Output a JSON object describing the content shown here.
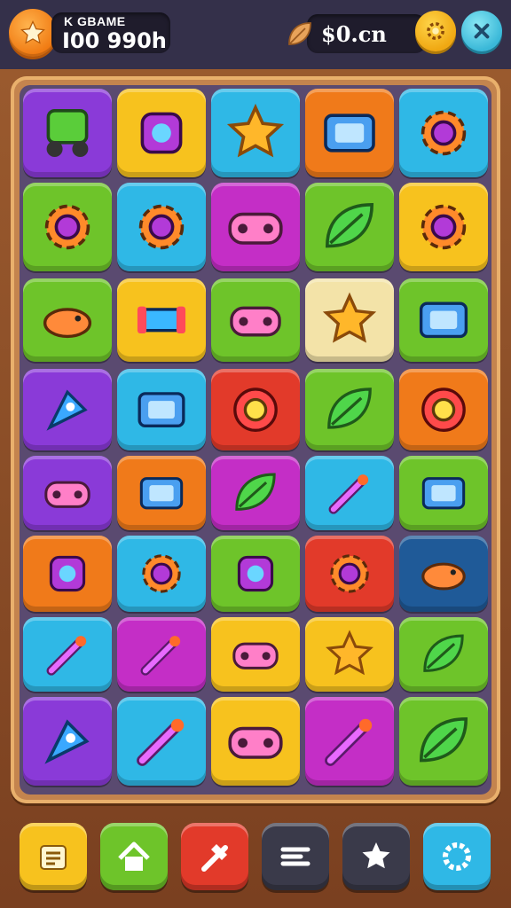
{
  "header": {
    "score_label": "K GBAME",
    "score_value": "I00 990h",
    "coin_value": "$0.cn"
  },
  "colors": {
    "purple": "#8a3ad8",
    "yellow": "#f7c21e",
    "cyan": "#2fb8e6",
    "orange": "#f07a1a",
    "blue": "#2f9fe6",
    "green": "#6ec42a",
    "magenta": "#c42ec6",
    "red": "#e23a2a",
    "cream": "#f3e3a8",
    "navy": "#1f5a98"
  },
  "board": {
    "tiles": [
      {
        "color": "#8a3ad8",
        "icon": "green-robot-tank-icon"
      },
      {
        "color": "#f7c21e",
        "icon": "square-gadget-icon"
      },
      {
        "color": "#2fb8e6",
        "icon": "starfish-toy-icon"
      },
      {
        "color": "#f07a1a",
        "icon": "handheld-console-icon"
      },
      {
        "color": "#2fb8e6",
        "icon": "blue-gear-ribbon-icon"
      },
      {
        "color": "#6ec42a",
        "icon": "magenta-gear-icon"
      },
      {
        "color": "#2fb8e6",
        "icon": "red-orb-gear-icon"
      },
      {
        "color": "#c42ec6",
        "icon": "green-gamepad-icon"
      },
      {
        "color": "#6ec42a",
        "icon": "green-leaf-icon"
      },
      {
        "color": "#f7c21e",
        "icon": "purple-gear-icon"
      },
      {
        "color": "#6ec42a",
        "icon": "orange-bird-icon"
      },
      {
        "color": "#f7c21e",
        "icon": "blue-tube-icon"
      },
      {
        "color": "#6ec42a",
        "icon": "purple-bone-icon"
      },
      {
        "color": "#f3e3a8",
        "icon": "yellow-burst-icon"
      },
      {
        "color": "#6ec42a",
        "icon": "card-gadget-icon"
      },
      {
        "color": "#8a3ad8",
        "icon": "yellow-rocket-icon"
      },
      {
        "color": "#2fb8e6",
        "icon": "blue-screen-icon"
      },
      {
        "color": "#e23a2a",
        "icon": "compass-orb-icon"
      },
      {
        "color": "#6ec42a",
        "icon": "green-leaf-icon"
      },
      {
        "color": "#f07a1a",
        "icon": "yellow-ring-icon"
      },
      {
        "color": "#8a3ad8",
        "icon": "pink-gamepad-icon"
      },
      {
        "color": "#f07a1a",
        "icon": "switch-console-icon"
      },
      {
        "color": "#c42ec6",
        "icon": "yellow-leaf-icon"
      },
      {
        "color": "#2fb8e6",
        "icon": "red-wand-icon"
      },
      {
        "color": "#6ec42a",
        "icon": "purple-sword-card-icon"
      },
      {
        "color": "#f07a1a",
        "icon": "blue-square-gadget-icon"
      },
      {
        "color": "#2fb8e6",
        "icon": "orange-gear-icon"
      },
      {
        "color": "#6ec42a",
        "icon": "purple-cross-gadget-icon"
      },
      {
        "color": "#e23a2a",
        "icon": "green-orb-gear-icon"
      },
      {
        "color": "#1f5a98",
        "icon": "teal-blob-icon"
      },
      {
        "color": "#2fb8e6",
        "icon": "yellow-hammer-icon"
      },
      {
        "color": "#c42ec6",
        "icon": "orange-arrow-icon"
      },
      {
        "color": "#f7c21e",
        "icon": "blue-bone-icon"
      },
      {
        "color": "#f7c21e",
        "icon": "orange-star-icon"
      },
      {
        "color": "#6ec42a",
        "icon": "green-swirl-leaf-icon"
      },
      {
        "color": "#8a3ad8",
        "icon": "blue-rocket-icon"
      },
      {
        "color": "#2fb8e6",
        "icon": "pink-blade-icon"
      },
      {
        "color": "#f7c21e",
        "icon": "pink-gamepad-icon"
      },
      {
        "color": "#c42ec6",
        "icon": "wrench-tool-icon"
      },
      {
        "color": "#6ec42a",
        "icon": "green-leaf-icon"
      }
    ]
  },
  "nav": [
    {
      "color": "#f7c21e",
      "icon": "list-icon"
    },
    {
      "color": "#6ec42a",
      "icon": "home-icon"
    },
    {
      "color": "#e23a2a",
      "icon": "hammer-icon"
    },
    {
      "color": "#3a3a4a",
      "icon": "menu-icon"
    },
    {
      "color": "#3a3a4a",
      "icon": "star-icon"
    },
    {
      "color": "#2fb8e6",
      "icon": "gear-icon"
    }
  ]
}
